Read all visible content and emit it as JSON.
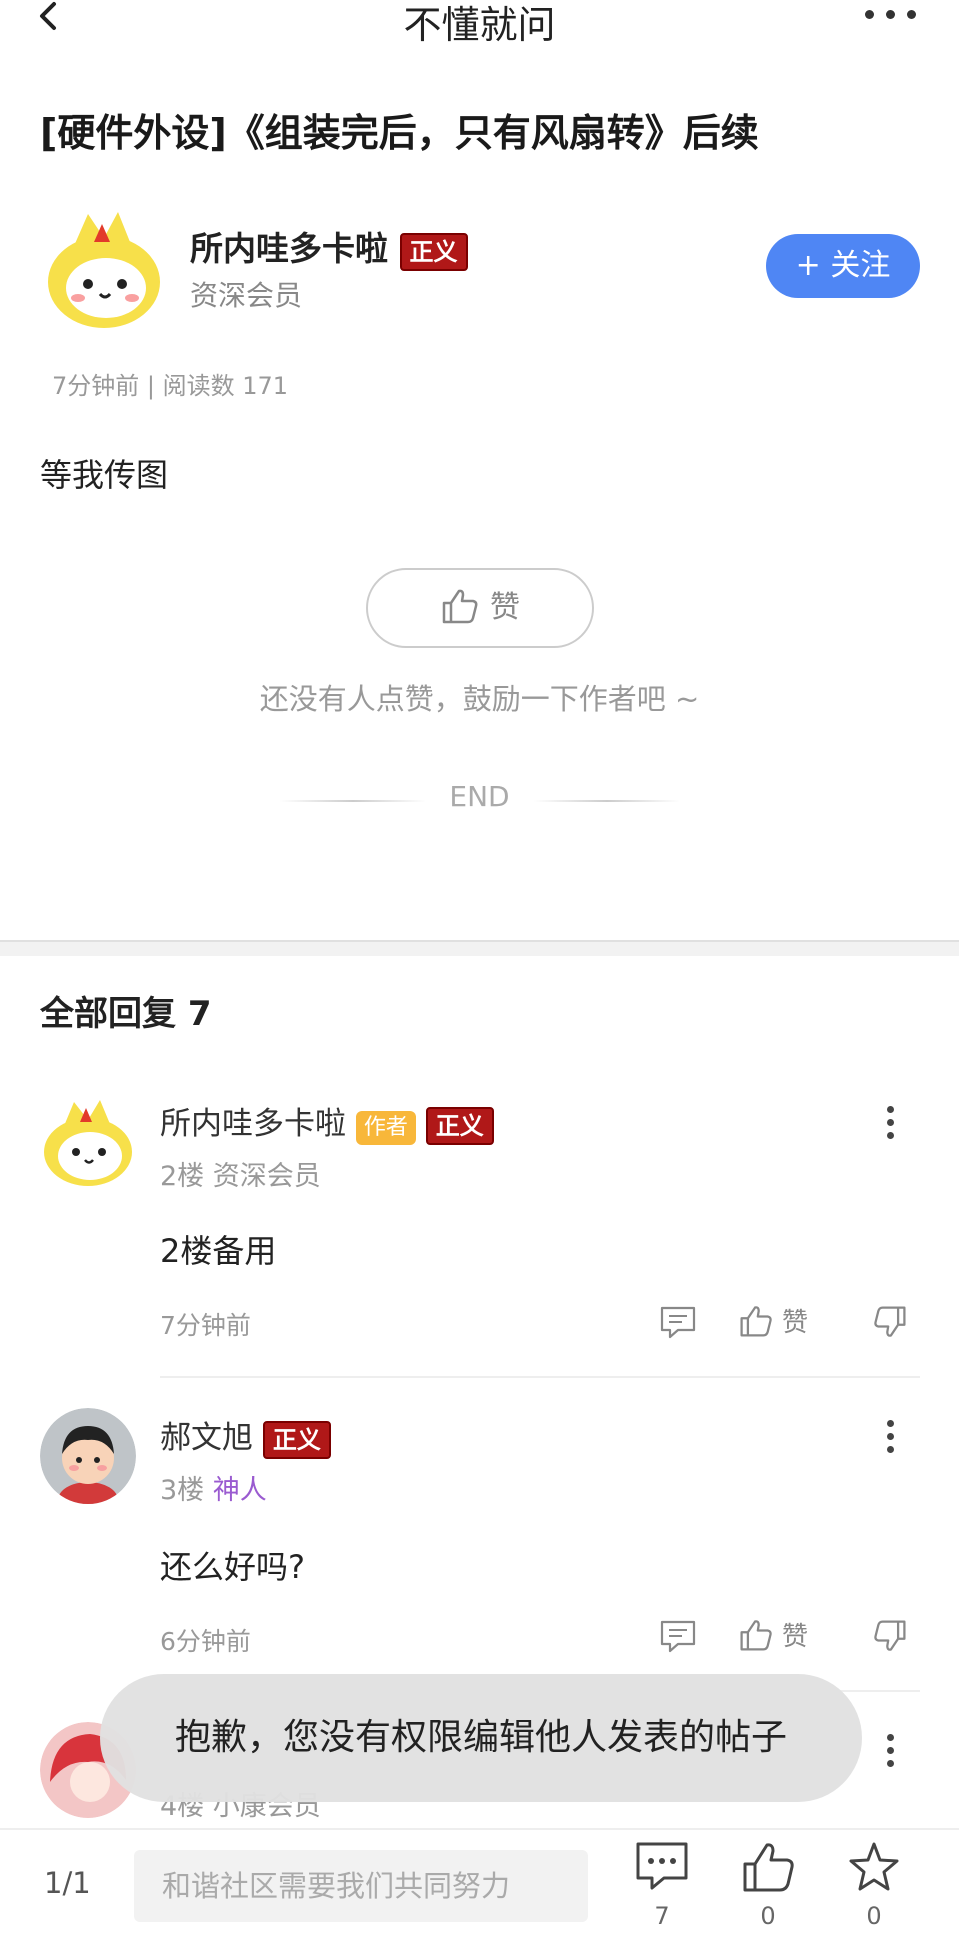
{
  "nav": {
    "title": "不懂就问"
  },
  "post": {
    "title": "[硬件外设]《组装完后，只有风扇转》后续",
    "author": {
      "name": "所内哇多卡啦",
      "badge": "正义",
      "level": "资深会员"
    },
    "follow_label": "+ 关注",
    "meta": "7分钟前 | 阅读数 171",
    "content": "等我传图",
    "like_label": "赞",
    "like_hint": "还没有人点赞，鼓励一下作者吧 ~",
    "end_label": "END"
  },
  "replies_header": "全部回复  7",
  "replies": [
    {
      "name": "所内哇多卡啦",
      "author_tag": "作者",
      "badge": "正义",
      "floor": "2楼",
      "level": "资深会员",
      "text": "2楼备用",
      "time": "7分钟前",
      "like_label": "赞"
    },
    {
      "name": "郝文旭",
      "badge": "正义",
      "floor": "3楼",
      "level": "神人",
      "text": "还么好吗?",
      "time": "6分钟前",
      "like_label": "赞"
    },
    {
      "floor": "4楼",
      "level": "小康会员"
    }
  ],
  "toast": "抱歉，您没有权限编辑他人发表的帖子",
  "bottom_bar": {
    "page": "1/1",
    "input_placeholder": "和谐社区需要我们共同努力",
    "comment_count": "7",
    "like_count": "0",
    "star_count": "0"
  },
  "colors": {
    "accent_blue": "#4f86f4",
    "badge_red": "#b01818",
    "author_tag": "#f8b73a",
    "level_purple": "#9a5bd0"
  }
}
